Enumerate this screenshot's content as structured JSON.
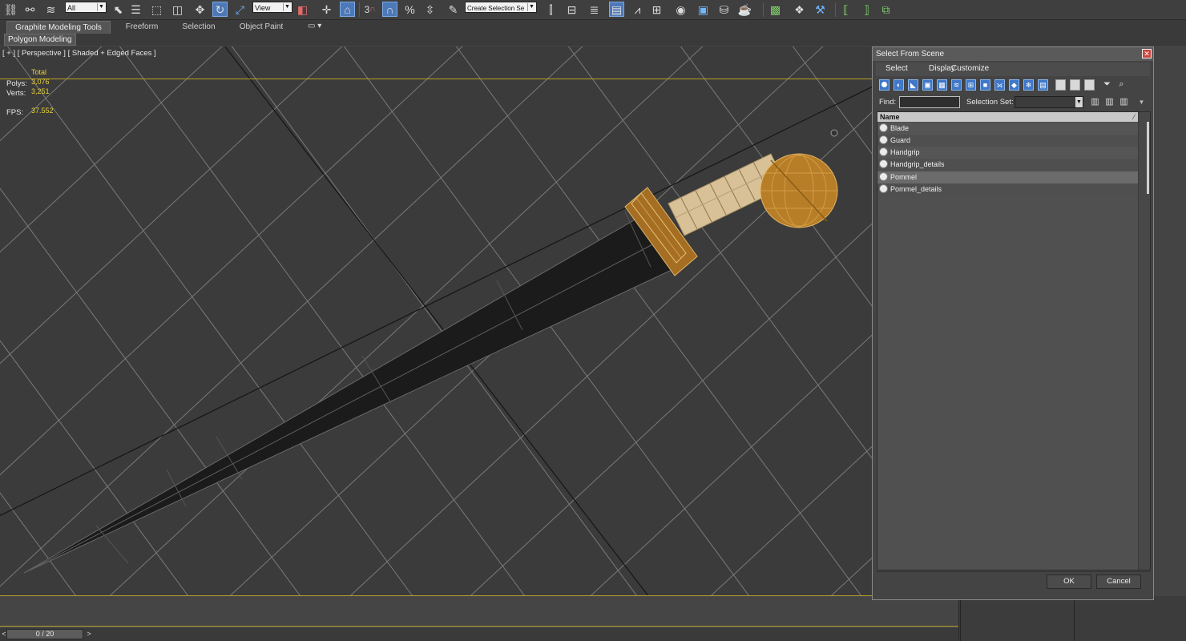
{
  "toolbar": {
    "filter_dropdown": "All",
    "ref_coord_dropdown": "View",
    "snap_label": "3",
    "named_sel_set": "Create Selection Se"
  },
  "ribbon": {
    "tabs": [
      {
        "label": "Graphite Modeling Tools"
      },
      {
        "label": "Freeform"
      },
      {
        "label": "Selection"
      },
      {
        "label": "Object Paint"
      }
    ],
    "panel": "Polygon Modeling"
  },
  "viewport": {
    "label": "[ + ] [ Perspective ] [ Shaded + Edged Faces ]",
    "stats": {
      "header": "Total",
      "polys_label": "Polys:",
      "polys_value": "3,076",
      "verts_label": "Verts:",
      "verts_value": "3,251",
      "fps_label": "FPS:",
      "fps_value": "37.552"
    },
    "colors": {
      "background": "#3b3b3b",
      "grid": "#7a7a7a",
      "blade": "#1b1b1b",
      "wood": "#d9c39a",
      "bronze": "#b07a25",
      "frame": "#b8a02a"
    }
  },
  "timeline": {
    "frame": "0 / 20",
    "prev": "<",
    "next": ">"
  },
  "dialog": {
    "title": "Select From Scene",
    "menu": [
      "Select",
      "Display",
      "Customize"
    ],
    "find_label": "Find:",
    "selection_set_label": "Selection Set:",
    "column_name": "Name",
    "items": [
      {
        "name": "Blade"
      },
      {
        "name": "Guard"
      },
      {
        "name": "Handgrip"
      },
      {
        "name": "Handgrip_details"
      },
      {
        "name": "Pommel"
      },
      {
        "name": "Pommel_details"
      }
    ],
    "selected_item": "Pommel",
    "ok": "OK",
    "cancel": "Cancel"
  }
}
